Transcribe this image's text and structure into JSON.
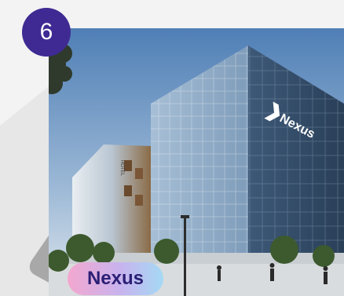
{
  "step": {
    "number": "6"
  },
  "card": {
    "label": "Nexus"
  },
  "image": {
    "alt": "Glass office building with Nexus logo",
    "logo_text": "Nexus",
    "hotel_text": "HOTEL"
  },
  "colors": {
    "badge": "#3f2a93",
    "label_text": "#2b1f75",
    "label_gradient_start": "#f3a7cf",
    "label_gradient_end": "#a5d9f4",
    "decor_gray": "#a8a8a8"
  }
}
